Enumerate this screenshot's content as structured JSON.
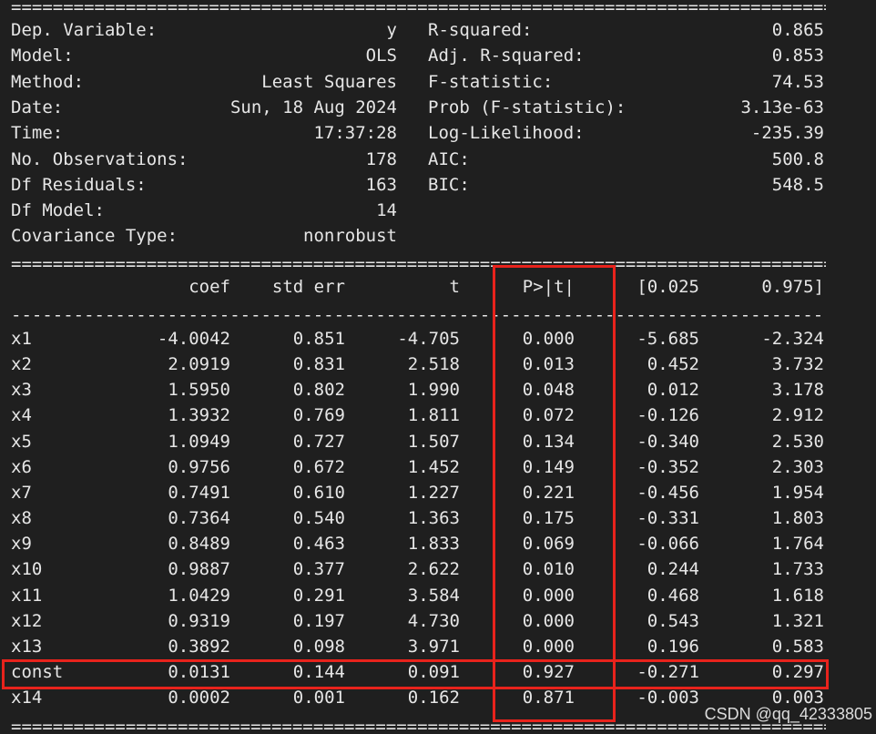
{
  "separator_double": "===============================================================================",
  "separator_single": "-------------------------------------------------------------------------------",
  "summary_left": [
    {
      "label": "Dep. Variable:",
      "value": "y"
    },
    {
      "label": "Model:",
      "value": "OLS"
    },
    {
      "label": "Method:",
      "value": "Least Squares"
    },
    {
      "label": "Date:",
      "value": "Sun, 18 Aug 2024"
    },
    {
      "label": "Time:",
      "value": "17:37:28"
    },
    {
      "label": "No. Observations:",
      "value": "178"
    },
    {
      "label": "Df Residuals:",
      "value": "163"
    },
    {
      "label": "Df Model:",
      "value": "14"
    },
    {
      "label": "Covariance Type:",
      "value": "nonrobust"
    }
  ],
  "summary_right": [
    {
      "label": "R-squared:",
      "value": "0.865"
    },
    {
      "label": "Adj. R-squared:",
      "value": "0.853"
    },
    {
      "label": "F-statistic:",
      "value": "74.53"
    },
    {
      "label": "Prob (F-statistic):",
      "value": "3.13e-63"
    },
    {
      "label": "Log-Likelihood:",
      "value": "-235.39"
    },
    {
      "label": "AIC:",
      "value": "500.8"
    },
    {
      "label": "BIC:",
      "value": "548.5"
    }
  ],
  "columns": [
    "coef",
    "std err",
    "t",
    "P>|t|",
    "[0.025",
    "0.975]"
  ],
  "rows": [
    [
      "x1",
      "-4.0042",
      "0.851",
      "-4.705",
      "0.000",
      "-5.685",
      "-2.324"
    ],
    [
      "x2",
      "2.0919",
      "0.831",
      "2.518",
      "0.013",
      "0.452",
      "3.732"
    ],
    [
      "x3",
      "1.5950",
      "0.802",
      "1.990",
      "0.048",
      "0.012",
      "3.178"
    ],
    [
      "x4",
      "1.3932",
      "0.769",
      "1.811",
      "0.072",
      "-0.126",
      "2.912"
    ],
    [
      "x5",
      "1.0949",
      "0.727",
      "1.507",
      "0.134",
      "-0.340",
      "2.530"
    ],
    [
      "x6",
      "0.9756",
      "0.672",
      "1.452",
      "0.149",
      "-0.352",
      "2.303"
    ],
    [
      "x7",
      "0.7491",
      "0.610",
      "1.227",
      "0.221",
      "-0.456",
      "1.954"
    ],
    [
      "x8",
      "0.7364",
      "0.540",
      "1.363",
      "0.175",
      "-0.331",
      "1.803"
    ],
    [
      "x9",
      "0.8489",
      "0.463",
      "1.833",
      "0.069",
      "-0.066",
      "1.764"
    ],
    [
      "x10",
      "0.9887",
      "0.377",
      "2.622",
      "0.010",
      "0.244",
      "1.733"
    ],
    [
      "x11",
      "1.0429",
      "0.291",
      "3.584",
      "0.000",
      "0.468",
      "1.618"
    ],
    [
      "x12",
      "0.9319",
      "0.197",
      "4.730",
      "0.000",
      "0.543",
      "1.321"
    ],
    [
      "x13",
      "0.3892",
      "0.098",
      "3.971",
      "0.000",
      "0.196",
      "0.583"
    ],
    [
      "const",
      "0.0131",
      "0.144",
      "0.091",
      "0.927",
      "-0.271",
      "0.297"
    ],
    [
      "x14",
      "0.0002",
      "0.001",
      "0.162",
      "0.871",
      "-0.003",
      "0.003"
    ]
  ],
  "watermark": "CSDN @qq_42333805",
  "highlight_color": "#e8231c"
}
